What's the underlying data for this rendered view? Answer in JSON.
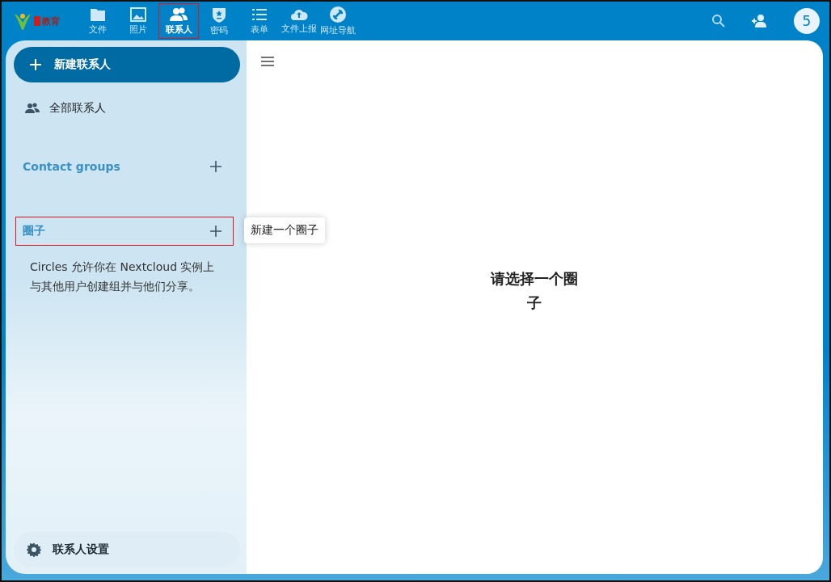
{
  "header": {
    "logo_text": "教育",
    "apps": [
      {
        "label": "文件",
        "kind": "folder",
        "selected": false
      },
      {
        "label": "照片",
        "kind": "image",
        "selected": false
      },
      {
        "label": "联系人",
        "kind": "contacts",
        "selected": true
      },
      {
        "label": "密码",
        "kind": "shield",
        "selected": false
      },
      {
        "label": "表单",
        "kind": "list",
        "selected": false
      },
      {
        "label": "文件上报",
        "kind": "upload",
        "selected": false
      },
      {
        "label": "网址导航",
        "kind": "link",
        "selected": false
      }
    ],
    "avatar": "5"
  },
  "sidebar": {
    "new_button": "新建联系人",
    "all_contacts": "全部联系人",
    "sections": [
      {
        "title": "Contact groups",
        "selected": false
      },
      {
        "title": "圈子",
        "selected": true,
        "tooltip": "新建一个圈子",
        "description": "Circles 允许你在 Nextcloud 实例上与其他用户创建组并与他们分享。"
      }
    ],
    "settings": "联系人设置"
  },
  "main": {
    "empty_message": "请选择一个圈子"
  }
}
